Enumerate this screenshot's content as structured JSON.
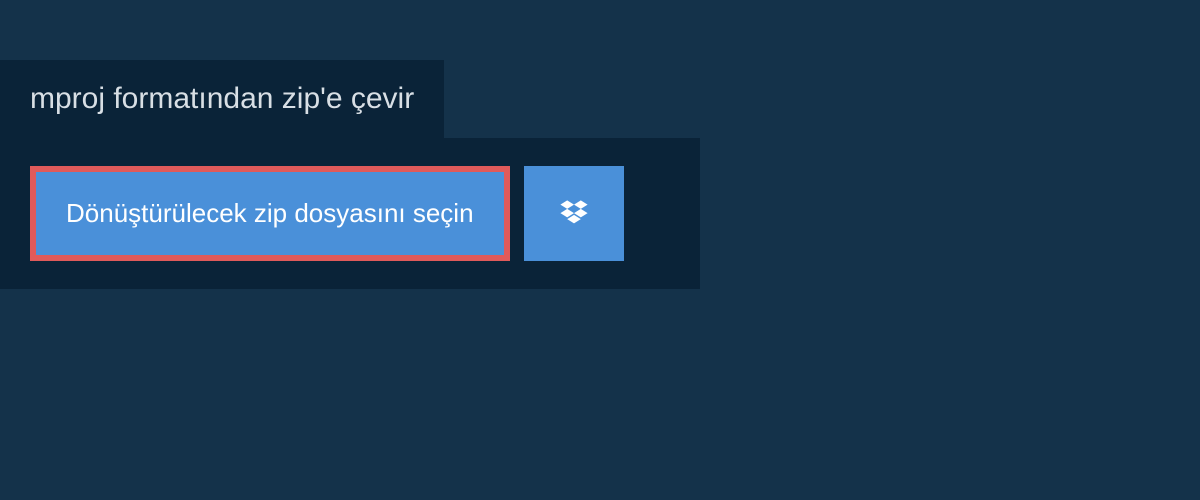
{
  "header": {
    "title": "mproj formatından zip'e çevir"
  },
  "actions": {
    "select_file_label": "Dönüştürülecek zip dosyasını seçin",
    "dropbox_icon": "dropbox-icon"
  },
  "colors": {
    "page_bg": "#14324a",
    "panel_bg": "#0a2338",
    "button_bg": "#4a90d9",
    "highlight_border": "#e05a5a"
  }
}
